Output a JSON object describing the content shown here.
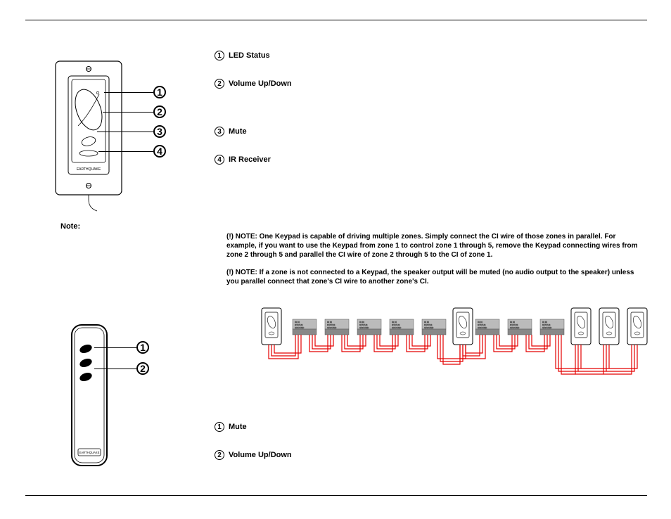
{
  "keypad_legend": {
    "item1": {
      "num": "1",
      "label": "LED Status"
    },
    "item2": {
      "num": "2",
      "label": "Volume Up/Down"
    },
    "item3": {
      "num": "3",
      "label": "Mute"
    },
    "item4": {
      "num": "4",
      "label": "IR Receiver"
    }
  },
  "keypad_callouts": {
    "n1": "1",
    "n2": "2",
    "n3": "3",
    "n4": "4"
  },
  "note_label": "Note:",
  "notes": {
    "p1": "(!) NOTE: One Keypad is capable of driving multiple zones. Simply connect the CI wire of those zones in parallel. For example, if you want to use the Keypad from zone 1 to control zone 1 through 5, remove the Keypad connecting wires from zone 2 through 5 and parallel the CI wire of zone 2 through 5 to the CI of zone 1.",
    "p2": "(!) NOTE: If a zone is not connected to a Keypad, the speaker output will be muted (no audio output to the speaker) unless you parallel connect that zone's CI wire to another zone's CI."
  },
  "remote_legend": {
    "item1": {
      "num": "1",
      "label": "Mute"
    },
    "item2": {
      "num": "2",
      "label": "Volume Up/Down"
    }
  },
  "remote_callouts": {
    "n1": "1",
    "n2": "2"
  },
  "keypad_brand": "EARTHQUAKE",
  "remote_brand": "EARTHQUAKE",
  "wiring_port_labels": "IR IN  STATUS  GROUND"
}
